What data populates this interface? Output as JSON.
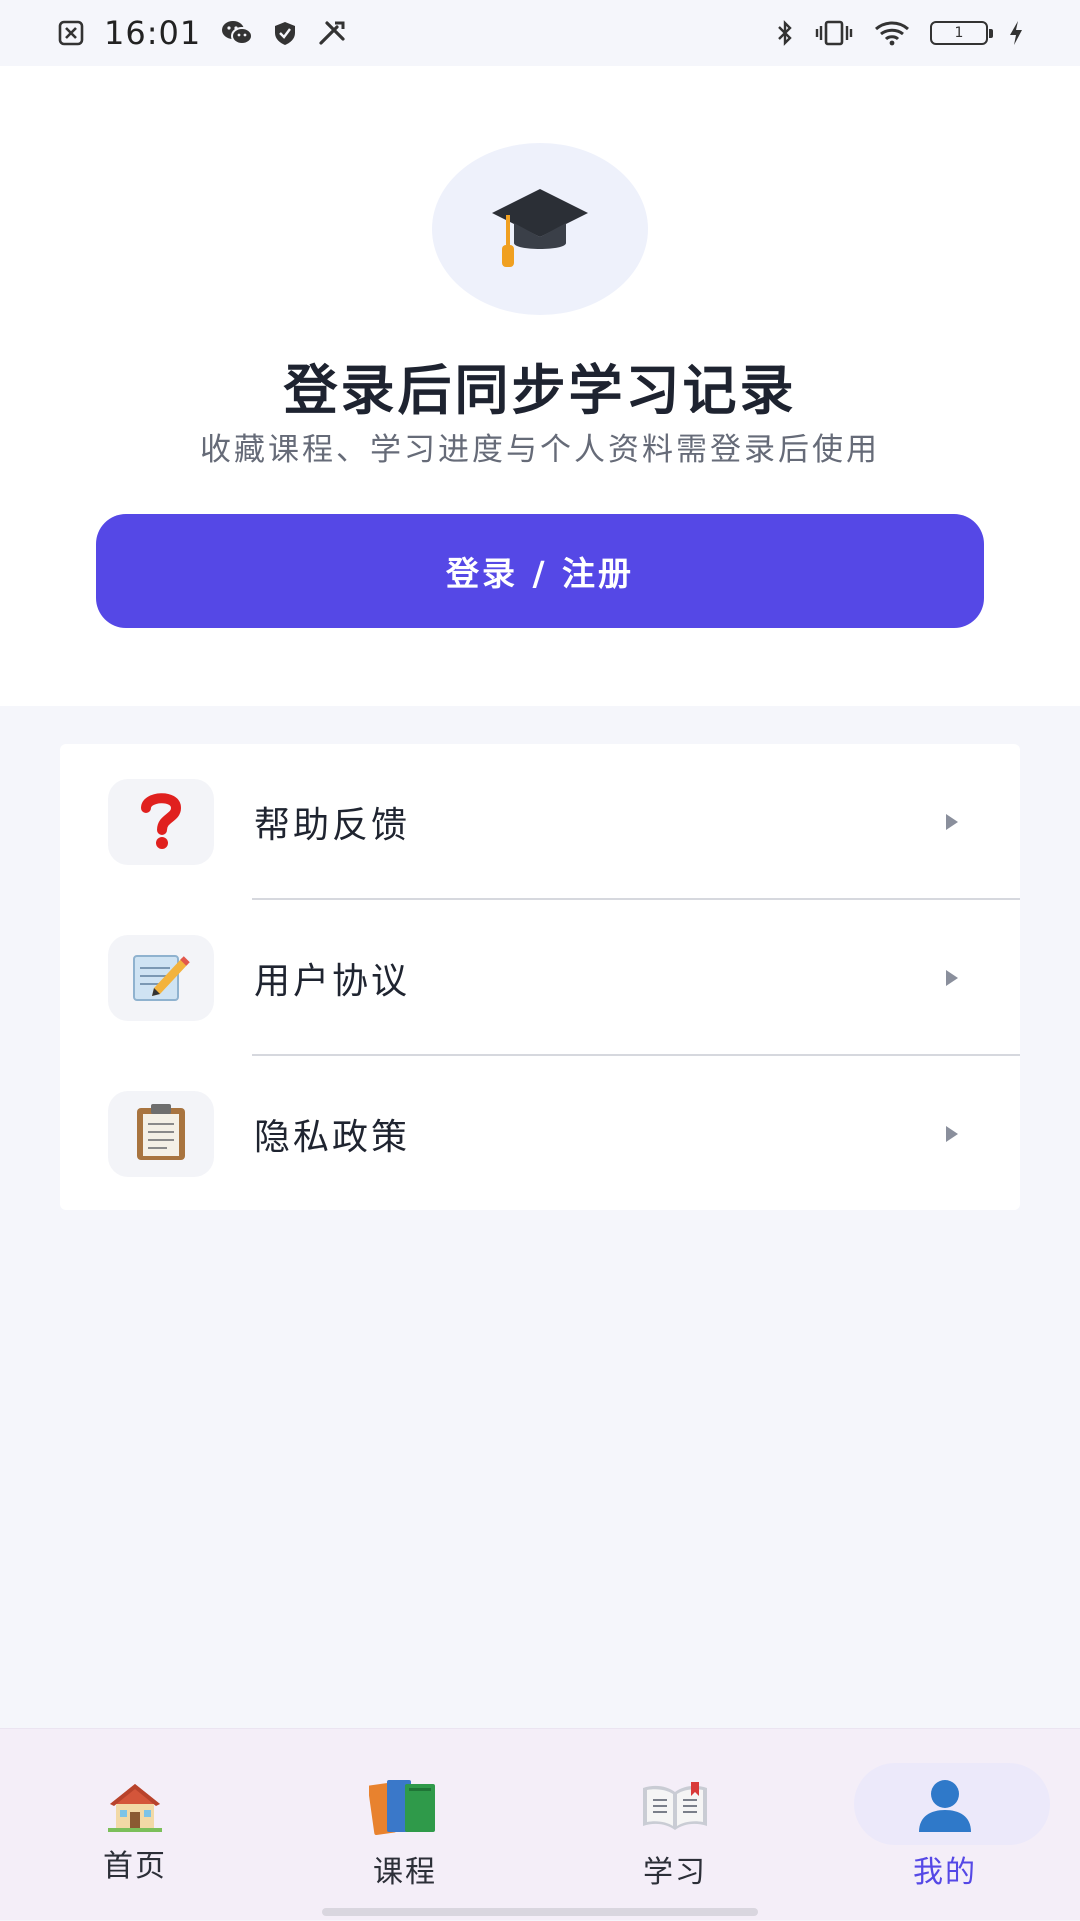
{
  "status_bar": {
    "time": "16:01",
    "left_icons": [
      "notification-close-icon",
      "wechat-icon",
      "shield-icon",
      "tools-icon"
    ],
    "right_icons": [
      "bluetooth-icon",
      "vibrate-icon",
      "wifi-icon",
      "battery-icon",
      "charging-icon"
    ],
    "battery_level": "1"
  },
  "login": {
    "icon": "graduation-cap-icon",
    "title": "登录后同步学习记录",
    "subtitle": "收藏课程、学习进度与个人资料需登录后使用",
    "button_label": "登录 / 注册",
    "accent_color": "#5548e6"
  },
  "menu": {
    "items": [
      {
        "icon": "question-mark-icon",
        "label": "帮助反馈"
      },
      {
        "icon": "memo-pencil-icon",
        "label": "用户协议"
      },
      {
        "icon": "clipboard-icon",
        "label": "隐私政策"
      }
    ]
  },
  "bottom_nav": {
    "items": [
      {
        "icon": "house-icon",
        "label": "首页",
        "active": false
      },
      {
        "icon": "books-icon",
        "label": "课程",
        "active": false
      },
      {
        "icon": "open-book-icon",
        "label": "学习",
        "active": false
      },
      {
        "icon": "user-icon",
        "label": "我的",
        "active": true
      }
    ]
  }
}
